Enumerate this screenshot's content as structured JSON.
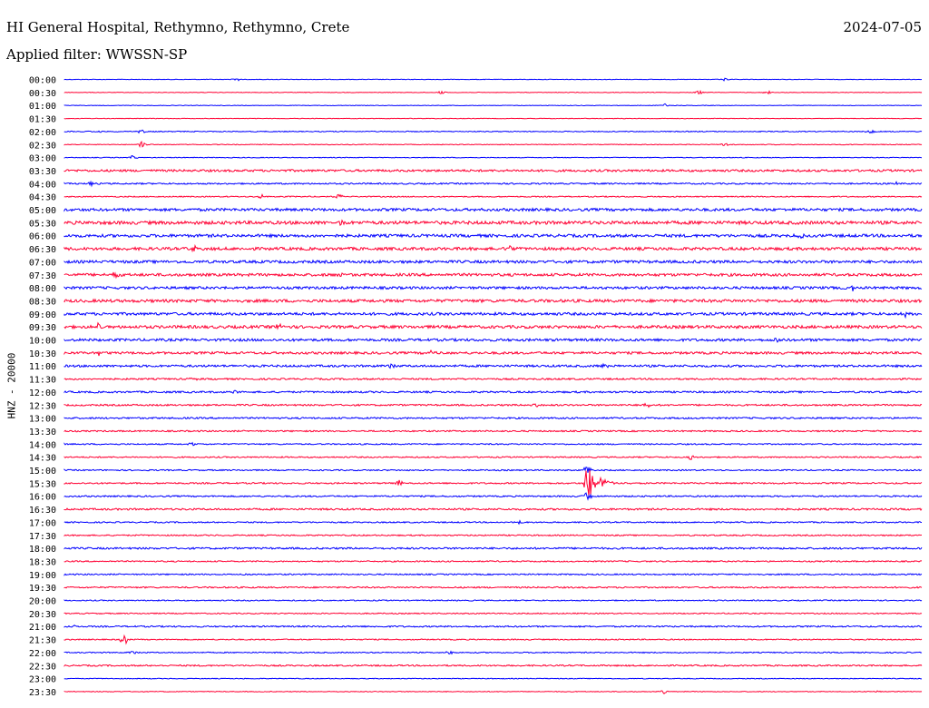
{
  "header": {
    "station": "HI General Hospital, Rethymno, Rethymno, Crete",
    "date": "2024-07-05",
    "filter": "Applied filter: WWSSN-SP"
  },
  "chart_data": {
    "type": "line",
    "title": "HI General Hospital, Rethymno, Rethymno, Crete",
    "date": "2024-07-05",
    "filter": "WWSSN-SP",
    "ylabel": "HNZ - 20000",
    "xlabel": "",
    "colors": [
      "#0000ff",
      "#ff0033"
    ],
    "rows": [
      {
        "label": "00:00",
        "noise": 0.3,
        "events": [
          {
            "pos": 0.2,
            "amp": 2
          },
          {
            "pos": 0.77,
            "amp": 2
          }
        ]
      },
      {
        "label": "00:30",
        "noise": 0.3,
        "events": [
          {
            "pos": 0.44,
            "amp": 2
          },
          {
            "pos": 0.74,
            "amp": 2
          },
          {
            "pos": 0.82,
            "amp": 2
          }
        ]
      },
      {
        "label": "01:00",
        "noise": 0.3,
        "events": [
          {
            "pos": 0.7,
            "amp": 2
          }
        ]
      },
      {
        "label": "01:30",
        "noise": 0.3,
        "events": []
      },
      {
        "label": "02:00",
        "noise": 0.5,
        "events": [
          {
            "pos": 0.04,
            "amp": 2
          },
          {
            "pos": 0.09,
            "amp": 2
          },
          {
            "pos": 0.94,
            "amp": 2
          }
        ]
      },
      {
        "label": "02:30",
        "noise": 0.4,
        "events": [
          {
            "pos": 0.09,
            "amp": 3
          },
          {
            "pos": 0.77,
            "amp": 2
          }
        ]
      },
      {
        "label": "03:00",
        "noise": 0.4,
        "events": [
          {
            "pos": 0.08,
            "amp": 2
          }
        ]
      },
      {
        "label": "03:30",
        "noise": 1.2,
        "events": []
      },
      {
        "label": "04:00",
        "noise": 0.8,
        "events": [
          {
            "pos": 0.03,
            "amp": 2
          },
          {
            "pos": 0.97,
            "amp": 2
          }
        ]
      },
      {
        "label": "04:30",
        "noise": 0.6,
        "events": [
          {
            "pos": 0.23,
            "amp": 3
          },
          {
            "pos": 0.32,
            "amp": 3
          }
        ]
      },
      {
        "label": "05:00",
        "noise": 1.5,
        "events": []
      },
      {
        "label": "05:30",
        "noise": 1.8,
        "events": [
          {
            "pos": 0.32,
            "amp": 3
          }
        ]
      },
      {
        "label": "06:00",
        "noise": 1.6,
        "events": [
          {
            "pos": 0.86,
            "amp": 3
          }
        ]
      },
      {
        "label": "06:30",
        "noise": 1.6,
        "events": [
          {
            "pos": 0.15,
            "amp": 3
          },
          {
            "pos": 0.52,
            "amp": 3
          }
        ]
      },
      {
        "label": "07:00",
        "noise": 1.5,
        "events": []
      },
      {
        "label": "07:30",
        "noise": 1.5,
        "events": [
          {
            "pos": 0.06,
            "amp": 3
          },
          {
            "pos": 0.32,
            "amp": 3
          }
        ]
      },
      {
        "label": "08:00",
        "noise": 1.4,
        "events": [
          {
            "pos": 0.92,
            "amp": 3
          }
        ]
      },
      {
        "label": "08:30",
        "noise": 1.6,
        "events": []
      },
      {
        "label": "09:00",
        "noise": 1.5,
        "events": [
          {
            "pos": 0.98,
            "amp": 3
          }
        ]
      },
      {
        "label": "09:30",
        "noise": 1.6,
        "events": [
          {
            "pos": 0.04,
            "amp": 4
          },
          {
            "pos": 0.25,
            "amp": 3
          }
        ]
      },
      {
        "label": "10:00",
        "noise": 1.4,
        "events": [
          {
            "pos": 0.83,
            "amp": 3
          }
        ]
      },
      {
        "label": "10:30",
        "noise": 1.3,
        "events": [
          {
            "pos": 0.04,
            "amp": 3
          },
          {
            "pos": 0.43,
            "amp": 3
          }
        ]
      },
      {
        "label": "11:00",
        "noise": 1.2,
        "events": [
          {
            "pos": 0.38,
            "amp": 3
          },
          {
            "pos": 0.63,
            "amp": 3
          }
        ]
      },
      {
        "label": "11:30",
        "noise": 0.9,
        "events": [
          {
            "pos": 0.15,
            "amp": 2
          }
        ]
      },
      {
        "label": "12:00",
        "noise": 1.0,
        "events": [
          {
            "pos": 0.2,
            "amp": 2
          }
        ]
      },
      {
        "label": "12:30",
        "noise": 0.9,
        "events": [
          {
            "pos": 0.55,
            "amp": 3
          },
          {
            "pos": 0.68,
            "amp": 3
          }
        ]
      },
      {
        "label": "13:00",
        "noise": 0.9,
        "events": []
      },
      {
        "label": "13:30",
        "noise": 0.8,
        "events": []
      },
      {
        "label": "14:00",
        "noise": 0.7,
        "events": [
          {
            "pos": 0.15,
            "amp": 2
          }
        ]
      },
      {
        "label": "14:30",
        "noise": 0.7,
        "events": [
          {
            "pos": 0.73,
            "amp": 3
          }
        ]
      },
      {
        "label": "15:00",
        "noise": 0.7,
        "events": [
          {
            "pos": 0.61,
            "amp": 6
          }
        ]
      },
      {
        "label": "15:30",
        "noise": 0.8,
        "events": [
          {
            "pos": 0.61,
            "amp": 20,
            "big": true
          },
          {
            "pos": 0.39,
            "amp": 3
          }
        ]
      },
      {
        "label": "16:00",
        "noise": 0.8,
        "events": [
          {
            "pos": 0.61,
            "amp": 5
          }
        ]
      },
      {
        "label": "16:30",
        "noise": 1.0,
        "events": []
      },
      {
        "label": "17:00",
        "noise": 0.7,
        "events": [
          {
            "pos": 0.53,
            "amp": 2
          }
        ]
      },
      {
        "label": "17:30",
        "noise": 0.7,
        "events": []
      },
      {
        "label": "18:00",
        "noise": 1.0,
        "events": []
      },
      {
        "label": "18:30",
        "noise": 0.7,
        "events": []
      },
      {
        "label": "19:00",
        "noise": 0.7,
        "events": [
          {
            "pos": 0.21,
            "amp": 2
          }
        ]
      },
      {
        "label": "19:30",
        "noise": 0.8,
        "events": []
      },
      {
        "label": "20:00",
        "noise": 0.6,
        "events": []
      },
      {
        "label": "20:30",
        "noise": 0.6,
        "events": []
      },
      {
        "label": "21:00",
        "noise": 0.8,
        "events": [
          {
            "pos": 0.01,
            "amp": 2
          }
        ]
      },
      {
        "label": "21:30",
        "noise": 0.6,
        "events": [
          {
            "pos": 0.07,
            "amp": 6
          }
        ]
      },
      {
        "label": "22:00",
        "noise": 0.6,
        "events": [
          {
            "pos": 0.08,
            "amp": 2
          },
          {
            "pos": 0.45,
            "amp": 2
          }
        ]
      },
      {
        "label": "22:30",
        "noise": 0.8,
        "events": []
      },
      {
        "label": "23:00",
        "noise": 0.4,
        "events": []
      },
      {
        "label": "23:30",
        "noise": 0.4,
        "events": [
          {
            "pos": 0.7,
            "amp": 2
          },
          {
            "pos": 0.95,
            "amp": 2
          }
        ]
      }
    ]
  }
}
